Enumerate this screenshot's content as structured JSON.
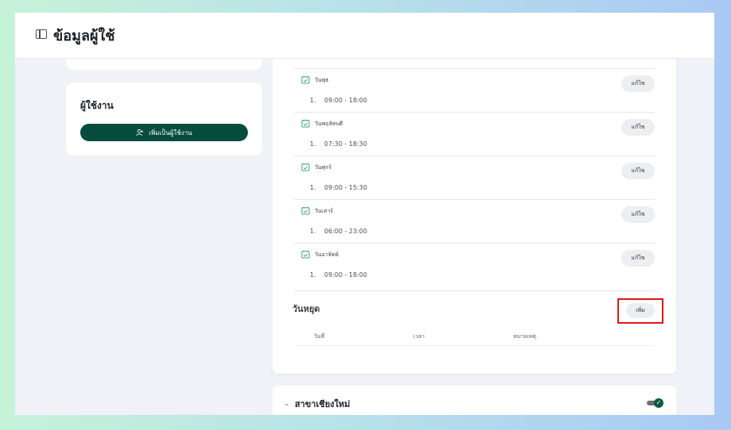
{
  "header": {
    "title": "ข้อมูลผู้ใช้",
    "icon": "sidebar-toggle-icon"
  },
  "users_card": {
    "heading": "ผู้ใช้งาน",
    "add_user_label": "เพิ่มเป็นผู้ใช้งาน",
    "add_user_icon": "user-plus-icon"
  },
  "schedule": [
    {
      "day": "วันพุธ",
      "index": "1.",
      "time": "09:00 - 18:00",
      "edit_label": "แก้ไข"
    },
    {
      "day": "วันพฤหัสบดี",
      "index": "1.",
      "time": "07:30 - 18:30",
      "edit_label": "แก้ไข"
    },
    {
      "day": "วันศุกร์",
      "index": "1.",
      "time": "09:00 - 15:30",
      "edit_label": "แก้ไข"
    },
    {
      "day": "วันเสาร์",
      "index": "1.",
      "time": "06:00 - 23:00",
      "edit_label": "แก้ไข"
    },
    {
      "day": "วันอาทิตย์",
      "index": "1.",
      "time": "09:00 - 18:00",
      "edit_label": "แก้ไข"
    }
  ],
  "holidays": {
    "title": "วันหยุด",
    "add_label": "เพิ่ม",
    "columns": [
      "วันที่",
      "เวลา",
      "หมายเหตุ"
    ]
  },
  "branch": {
    "title": "สาขาเชียงใหม่",
    "toggle_on": true
  },
  "colors": {
    "primary": "#064d3e",
    "highlight": "#e01515",
    "calendar_icon": "#2e9e5b"
  }
}
